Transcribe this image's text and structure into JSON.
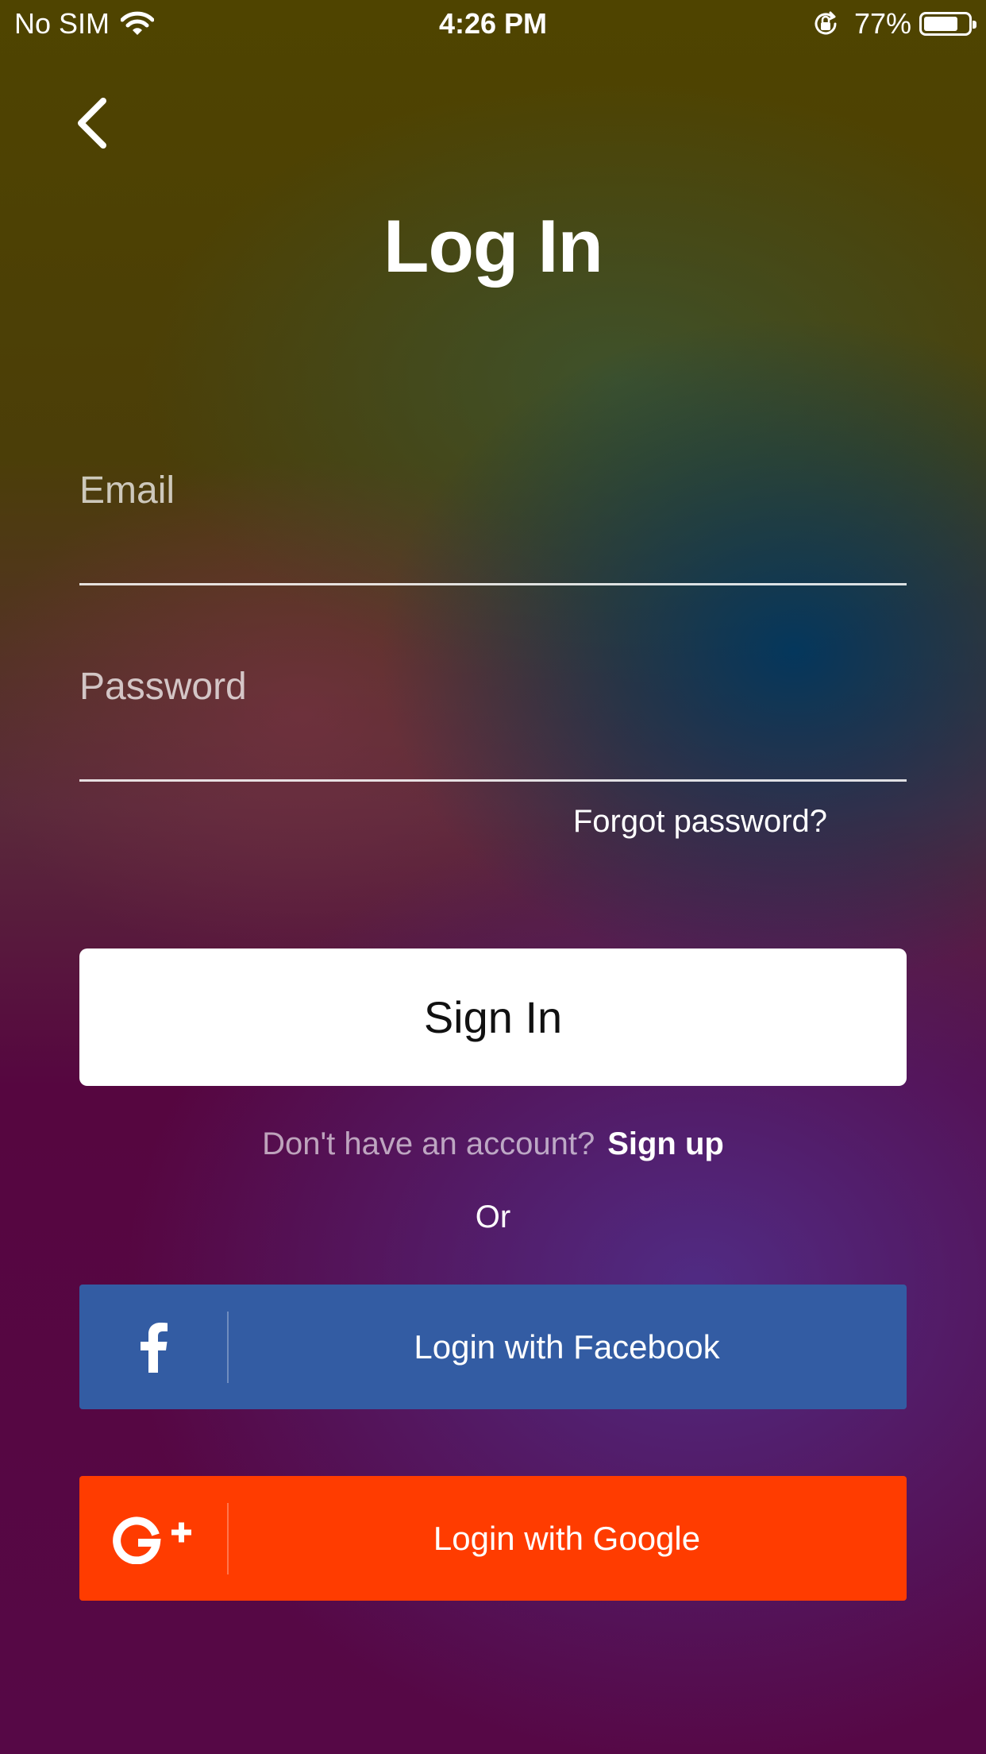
{
  "status_bar": {
    "carrier": "No SIM",
    "time": "4:26 PM",
    "battery_percent": "77%",
    "battery_level": 0.77,
    "icons": [
      "wifi-icon",
      "orientation-lock-icon",
      "battery-icon"
    ]
  },
  "header": {
    "back_icon": "chevron-left-icon",
    "title": "Log In"
  },
  "form": {
    "email": {
      "placeholder": "Email",
      "value": ""
    },
    "password": {
      "placeholder": "Password",
      "value": ""
    },
    "forgot_password": "Forgot password?",
    "sign_in": "Sign In"
  },
  "signup": {
    "prompt": "Don't have an account?",
    "link": "Sign up"
  },
  "divider_text": "Or",
  "social": {
    "facebook": {
      "label": "Login with Facebook",
      "icon": "facebook-icon",
      "color": "#335ca3"
    },
    "google": {
      "label": "Login with Google",
      "icon": "google-plus-icon",
      "color": "#ff3c00"
    }
  },
  "colors": {
    "background_top": "#4f4400",
    "background_bottom": "#560846",
    "sign_in_bg": "#ffffff"
  }
}
